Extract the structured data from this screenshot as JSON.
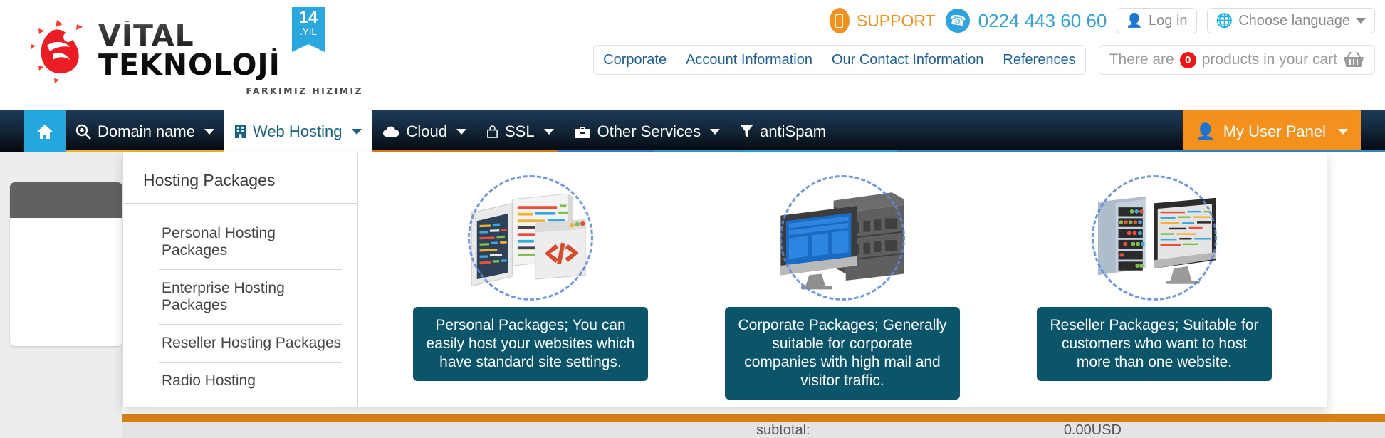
{
  "brand": {
    "name": "VİTAL TEKNOLOJİ",
    "slogan": "FARKIMIZ HIZIMIZ",
    "anniversary_number": "14",
    "anniversary_label": ".YIL",
    "logo_icon": "vital-flame-logo",
    "accent_orange": "#f3911c",
    "accent_blue": "#23a7dd",
    "accent_teal": "#0b556b",
    "nav_dark": "#14283c"
  },
  "header": {
    "support": {
      "label": "SUPPORT",
      "icon": "mobile-phone-icon"
    },
    "phone": {
      "number": "0224 443 60 60",
      "icon": "phone-call-icon"
    },
    "login": {
      "label": "Log in",
      "icon": "user-icon"
    },
    "language": {
      "label": "Choose language",
      "icon": "globe-icon",
      "caret": "chevron-down-icon"
    },
    "quick_links": [
      {
        "label": "Corporate"
      },
      {
        "label": "Account Information"
      },
      {
        "label": "Our Contact Information"
      },
      {
        "label": "References"
      }
    ],
    "cart": {
      "text_before": "There are",
      "count": "0",
      "text_after": "products in your cart",
      "icon": "shopping-basket-icon"
    }
  },
  "mainnav": {
    "home": {
      "label": "Home",
      "icon": "home-icon"
    },
    "items": [
      {
        "label": "Domain name",
        "icon": "magnifier-plus-icon",
        "has_caret": true,
        "active": false,
        "underline": "#e8b827"
      },
      {
        "label": "Web Hosting",
        "icon": "building-icon",
        "has_caret": true,
        "active": true,
        "underline": "#d98013"
      },
      {
        "label": "Cloud",
        "icon": "cloud-icon",
        "has_caret": true,
        "active": false,
        "underline": "#3a7fd5"
      },
      {
        "label": "SSL",
        "icon": "lock-icon",
        "has_caret": true,
        "active": false,
        "underline": "#2d9bd6"
      },
      {
        "label": "Other Services",
        "icon": "briefcase-icon",
        "has_caret": true,
        "active": false,
        "underline": "#23a7dd"
      },
      {
        "label": "antiSpam",
        "icon": "funnel-icon",
        "has_caret": false,
        "active": false,
        "underline": "#2f86c5"
      }
    ],
    "user_panel": {
      "label": "My User Panel",
      "icon": "user-icon",
      "caret": "chevron-down-icon"
    }
  },
  "dropdown": {
    "title": "Hosting Packages",
    "links": [
      {
        "label": "Personal Hosting Packages"
      },
      {
        "label": "Enterprise Hosting Packages"
      },
      {
        "label": "Reseller Hosting Packages"
      },
      {
        "label": "Radio Hosting"
      }
    ],
    "cards": [
      {
        "icon": "tablet-code-window-icon",
        "caption": "Personal Packages; You can easily host your websites which have standard site settings."
      },
      {
        "icon": "monitor-server-rack-icon",
        "caption": "Corporate Packages; Generally suitable for corporate companies with high mail and visitor traffic."
      },
      {
        "icon": "server-cabinet-monitor-icon",
        "caption": "Reseller Packages; Suitable for customers who want to host more than one website."
      }
    ]
  },
  "footer_strip": {
    "subtotal_label": "subtotal:",
    "subtotal_value": "0.00USD"
  }
}
